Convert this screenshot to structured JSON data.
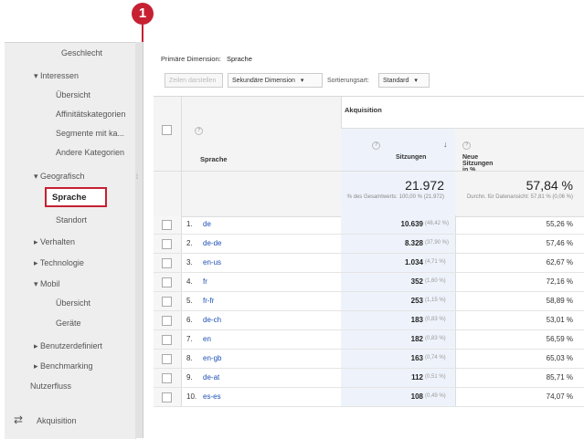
{
  "callout": {
    "number": "1"
  },
  "sidebar": {
    "items": [
      {
        "label": "Geschlecht"
      },
      {
        "label": "▾ Interessen"
      },
      {
        "label": "Übersicht"
      },
      {
        "label": "Affinitätskategorien"
      },
      {
        "label": "Segmente mit ka..."
      },
      {
        "label": "Andere Kategorien"
      },
      {
        "label": "▾ Geografisch"
      },
      {
        "label": "Sprache"
      },
      {
        "label": "Standort"
      },
      {
        "label": "▸ Verhalten"
      },
      {
        "label": "▸ Technologie"
      },
      {
        "label": "▾ Mobil"
      },
      {
        "label": "Übersicht"
      },
      {
        "label": "Geräte"
      },
      {
        "label": "▸ Benutzerdefiniert"
      },
      {
        "label": "▸ Benchmarking"
      },
      {
        "label": "Nutzerfluss"
      },
      {
        "label": "Akquisition"
      }
    ]
  },
  "toolbar": {
    "primary_dimension_label": "Primäre Dimension:",
    "primary_dimension_value": "Sprache",
    "plot_rows_label": "Zeilen darstellen",
    "secondary_dimension_label": "Sekundäre Dimension",
    "sort_label": "Sortierungsart:",
    "sort_value": "Standard"
  },
  "table": {
    "dim_header": "Sprache",
    "group_header": "Akquisition",
    "col_sessions": "Sitzungen",
    "col_new_sessions": "Neue Sitzungen in %",
    "totals": {
      "sessions": "21.972",
      "sessions_sub": "% des Gesamtwerts: 100,00 % (21.972)",
      "new_sessions": "57,84 %",
      "new_sessions_sub": "Durchn. für Datenansicht: 57,81 % (0,06 %)"
    },
    "rows": [
      {
        "idx": "1.",
        "name": "de",
        "sessions": "10.639",
        "pct": "(48,42 %)",
        "new": "55,26 %"
      },
      {
        "idx": "2.",
        "name": "de-de",
        "sessions": "8.328",
        "pct": "(37,90 %)",
        "new": "57,46 %"
      },
      {
        "idx": "3.",
        "name": "en-us",
        "sessions": "1.034",
        "pct": "(4,71 %)",
        "new": "62,67 %"
      },
      {
        "idx": "4.",
        "name": "fr",
        "sessions": "352",
        "pct": "(1,60 %)",
        "new": "72,16 %"
      },
      {
        "idx": "5.",
        "name": "fr-fr",
        "sessions": "253",
        "pct": "(1,15 %)",
        "new": "58,89 %"
      },
      {
        "idx": "6.",
        "name": "de-ch",
        "sessions": "183",
        "pct": "(0,83 %)",
        "new": "53,01 %"
      },
      {
        "idx": "7.",
        "name": "en",
        "sessions": "182",
        "pct": "(0,83 %)",
        "new": "56,59 %"
      },
      {
        "idx": "8.",
        "name": "en-gb",
        "sessions": "163",
        "pct": "(0,74 %)",
        "new": "65,03 %"
      },
      {
        "idx": "9.",
        "name": "de-at",
        "sessions": "112",
        "pct": "(0,51 %)",
        "new": "85,71 %"
      },
      {
        "idx": "10.",
        "name": "es-es",
        "sessions": "108",
        "pct": "(0,49 %)",
        "new": "74,07 %"
      }
    ]
  },
  "colors": {
    "accent": "#c62032",
    "link": "#1a4fb5"
  }
}
